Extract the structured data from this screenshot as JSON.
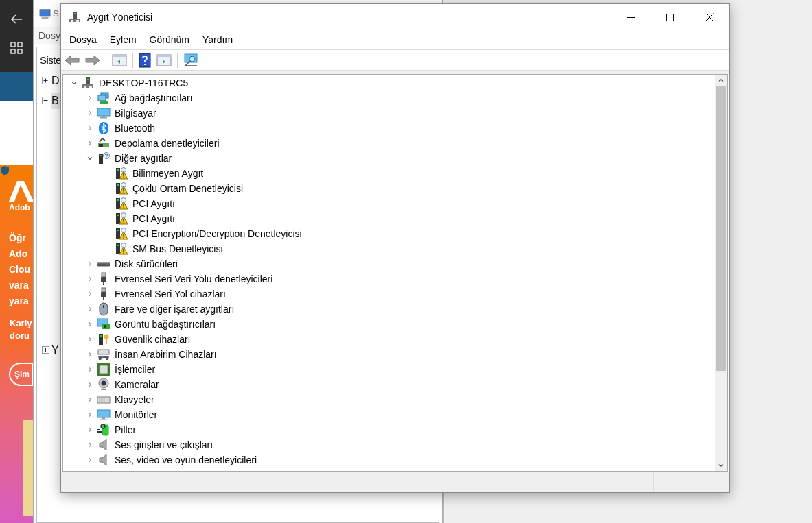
{
  "background_window": {
    "title": "S",
    "menu": [
      "Dosy"
    ],
    "tree_root": "Siste",
    "tree": [
      {
        "label": "D",
        "expanded": false,
        "selected": false
      },
      {
        "label": "B",
        "expanded": true,
        "selected": true
      },
      {
        "label": "Y",
        "expanded": false,
        "selected": false
      }
    ]
  },
  "ad": {
    "brand": "Adob",
    "headline": [
      "Öğr",
      "Ado",
      "Clou",
      "vara",
      "yara"
    ],
    "subline": [
      "Kariy",
      "doru"
    ],
    "button": "Şim"
  },
  "window": {
    "title": "Aygıt Yöneticisi"
  },
  "menu": [
    "Dosya",
    "Eylem",
    "Görünüm",
    "Yardım"
  ],
  "tree": {
    "label": "DESKTOP-116TRC5",
    "expanded": true,
    "children": [
      {
        "label": "Ağ bağdaştırıcıları",
        "kind": "network",
        "expanded": false
      },
      {
        "label": "Bilgisayar",
        "kind": "computer",
        "expanded": false
      },
      {
        "label": "Bluetooth",
        "kind": "bluetooth",
        "expanded": false
      },
      {
        "label": "Depolama denetleyicileri",
        "kind": "storage",
        "expanded": false
      },
      {
        "label": "Diğer aygıtlar",
        "kind": "other",
        "expanded": true,
        "children": [
          {
            "label": "Bilinmeyen Aygıt",
            "kind": "warning"
          },
          {
            "label": "Çoklu Ortam Denetleyicisi",
            "kind": "warning"
          },
          {
            "label": "PCI Aygıtı",
            "kind": "warning"
          },
          {
            "label": "PCI Aygıtı",
            "kind": "warning"
          },
          {
            "label": "PCI Encryption/Decryption Denetleyicisi",
            "kind": "warning"
          },
          {
            "label": "SM Bus Denetleyicisi",
            "kind": "warning"
          }
        ]
      },
      {
        "label": "Disk sürücüleri",
        "kind": "disk",
        "expanded": false
      },
      {
        "label": "Evrensel Seri Veri Yolu denetleyicileri",
        "kind": "usb",
        "expanded": false
      },
      {
        "label": "Evrensel Seri Yol cihazları",
        "kind": "usb",
        "expanded": false
      },
      {
        "label": "Fare ve diğer işaret aygıtları",
        "kind": "mouse",
        "expanded": false
      },
      {
        "label": "Görüntü bağdaştırıcıları",
        "kind": "display",
        "expanded": false
      },
      {
        "label": "Güvenlik cihazları",
        "kind": "security",
        "expanded": false
      },
      {
        "label": "İnsan Arabirim Cihazları",
        "kind": "hid",
        "expanded": false
      },
      {
        "label": "İşlemciler",
        "kind": "cpu",
        "expanded": false
      },
      {
        "label": "Kameralar",
        "kind": "camera",
        "expanded": false
      },
      {
        "label": "Klavyeler",
        "kind": "keyboard",
        "expanded": false
      },
      {
        "label": "Monitörler",
        "kind": "monitor",
        "expanded": false
      },
      {
        "label": "Piller",
        "kind": "battery",
        "expanded": false
      },
      {
        "label": "Ses girişleri ve çıkışları",
        "kind": "audio",
        "expanded": false
      },
      {
        "label": "Ses, video ve oyun denetleyicileri",
        "kind": "audio",
        "expanded": false
      }
    ]
  }
}
